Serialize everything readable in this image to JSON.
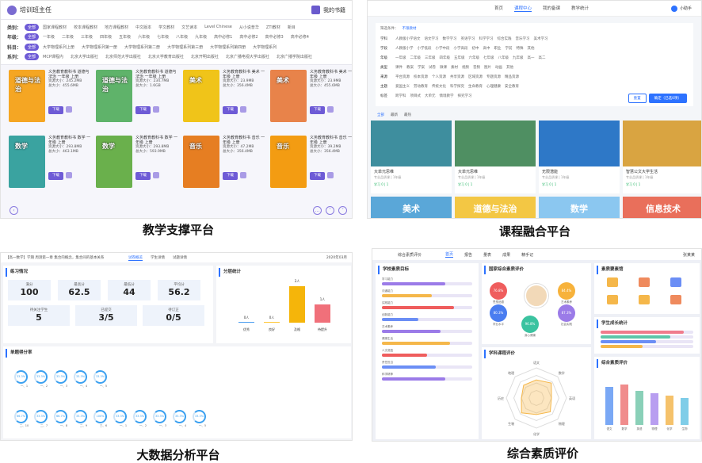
{
  "captions": {
    "p1": "教学支撑平台",
    "p2": "课程融合平台",
    "p3": "大数据分析平台",
    "p4": "综合素质评价"
  },
  "p1": {
    "user": "培训班主任",
    "shelf": "我的书籍",
    "filters": [
      {
        "label": "类别：",
        "all": "全部",
        "options": [
          "国家课程教材",
          "校本课程教材",
          "地方课程教材",
          "中文版本",
          "学文教材",
          "文艺读本",
          "Level Chinese",
          "从小说普华",
          "ZTI教材",
          "新目"
        ]
      },
      {
        "label": "年级：",
        "all": "全部",
        "options": [
          "一年级",
          "二年级",
          "三年级",
          "四年级",
          "五年级",
          "六年级",
          "七年级",
          "八年级",
          "九年级",
          "高中必修1",
          "高中必修2",
          "高中必修3",
          "高中必修4"
        ]
      },
      {
        "label": "科目：",
        "all": "全部",
        "options": [
          "大学物理系列上册",
          "大学物理系列第一册",
          "大学物理系列第二册",
          "大学物理系列第三册",
          "大学物理系列第四册",
          "大学物理系列"
        ]
      },
      {
        "label": "系列：",
        "all": "全部",
        "options": [
          "MCP课程内",
          "北京大学出版社",
          "北京师范大学出版社",
          "北京大学教育出版社",
          "北京开明出版社",
          "北京广播电视大学出版社",
          "北京广播学院出版社"
        ]
      }
    ],
    "books": [
      {
        "cover": "道德与法治",
        "title": "义务教育教科书 道德与法治 一年级 上册",
        "size1": "245.2MB",
        "size2": "455.6MB",
        "color": "#f5a623"
      },
      {
        "cover": "道德与法治",
        "title": "义务教育教科书 道德与法治 一年级 上册",
        "size1": "234.7MB",
        "size2": "1.6GB",
        "color": "#5fb36a"
      },
      {
        "cover": "美术",
        "title": "义务教育教科书 美术 一年级 上册",
        "size1": "23.9MB",
        "size2": "356.4MB",
        "color": "#f0c419"
      },
      {
        "cover": "美术",
        "title": "义务教育教科书 美术 一年级 上册",
        "size1": "23.9MB",
        "size2": "455.6MB",
        "color": "#e8834a"
      },
      {
        "cover": "数学",
        "title": "义务教育教科书 数学 一年级 上册",
        "size1": "293.8MB",
        "size2": "463.1MB",
        "color": "#3aa3a0"
      },
      {
        "cover": "数学",
        "title": "义务教育教科书 数学 一年级 上册",
        "size1": "293.8MB",
        "size2": "593.9MB",
        "color": "#6ab04c"
      },
      {
        "cover": "音乐",
        "title": "义务教育教科书 音乐 一年级 上册",
        "size1": "47.2MB",
        "size2": "356.4MB",
        "color": "#e67e22"
      },
      {
        "cover": "音乐",
        "title": "义务教育教科书 音乐 一年级 上册",
        "size1": "39.2MB",
        "size2": "356.4MB",
        "color": "#f39c12"
      }
    ],
    "download": "下载",
    "size_label1": "资源大小：",
    "size_label2": "总大小："
  },
  "p2": {
    "nav": [
      "首页",
      "课程中心",
      "我的备课",
      "教学统计"
    ],
    "nav_active": 1,
    "user": "小助手",
    "filter_label": "筛选条件：",
    "filter_sel": "不限教材",
    "rows": [
      {
        "label": "学科",
        "opts": [
          "人教版小学语文",
          "语文学习",
          "数学学习",
          "英语学习",
          "科学学习",
          "综合实践",
          "音乐学习",
          "美术学习"
        ]
      },
      {
        "label": "学段",
        "opts": [
          "人教版小学",
          "小学低段",
          "小学中段",
          "小学高段",
          "初中",
          "高中",
          "职业",
          "学前",
          "特殊",
          "其他"
        ]
      },
      {
        "label": "年级",
        "opts": [
          "一年级",
          "二年级",
          "三年级",
          "四年级",
          "五年级",
          "六年级",
          "七年级",
          "八年级",
          "九年级",
          "高一",
          "高二"
        ]
      },
      {
        "label": "类型",
        "opts": [
          "课件",
          "教案",
          "学案",
          "试卷",
          "微课",
          "素材",
          "视频",
          "音频",
          "图片",
          "动画",
          "其他"
        ]
      },
      {
        "label": "来源",
        "opts": [
          "平台资源",
          "校本资源",
          "个人资源",
          "共享资源",
          "区域资源",
          "专题资源",
          "精品资源"
        ]
      },
      {
        "label": "主题",
        "opts": [
          "爱国主义",
          "劳动教育",
          "传统文化",
          "科学探究",
          "生命教育",
          "心理健康",
          "安全教育"
        ]
      },
      {
        "label": "标签",
        "opts": [
          "跨学科",
          "项目式",
          "大单元",
          "情境教学",
          "探究学习"
        ]
      }
    ],
    "btn_reset": "重置",
    "btn_ok": "确定（已选0项）",
    "tabs": [
      "全部",
      "最新",
      "最热"
    ],
    "cards": [
      {
        "title": "大单元思维",
        "meta": "专业品质课 | 1年级",
        "tag": "学习 0 | 1",
        "color": "#3e8e9e"
      },
      {
        "title": "大单元思维",
        "meta": "专业品质课 | 1年级",
        "tag": "学习 0 | 1",
        "color": "#4f8f62"
      },
      {
        "title": "无限潜能",
        "meta": "专业品质课 | 1年级",
        "tag": "学习 0 | 1",
        "color": "#2e78c7"
      },
      {
        "title": "智慧公文大学生活",
        "meta": "专业品质课 | 1年级",
        "tag": "学习 0 | 1",
        "color": "#d9a441"
      }
    ],
    "row2": [
      "美术",
      "道德与法治",
      "数学",
      "信息技术"
    ]
  },
  "p3": {
    "crumb": "【高一数学】学期 周测第一章 集合的概念，集合间的基本关系",
    "tabs": [
      "试卷概览",
      "学生详情",
      "试题详情"
    ],
    "tab_active": 0,
    "date": "2020年03月",
    "section1": "练习情况",
    "stats": [
      {
        "label": "满分",
        "value": "100"
      },
      {
        "label": "最高分",
        "value": "62.5"
      },
      {
        "label": "最低分",
        "value": "44"
      },
      {
        "label": "平均分",
        "value": "56.2"
      }
    ],
    "stats2": [
      {
        "label": "待关注学生",
        "value": "5"
      },
      {
        "label": "已提交",
        "value": "3/5"
      },
      {
        "label": "待订正",
        "value": "0/5"
      }
    ],
    "section2": "分层统计",
    "chart_data": {
      "type": "bar",
      "categories": [
        "优秀",
        "良好",
        "及格",
        "待提升"
      ],
      "values": [
        0,
        0,
        2,
        1
      ],
      "labels": [
        "0人",
        "0人",
        "2人",
        "1人"
      ],
      "colors": [
        "#4a9df0",
        "#ffc736",
        "#f5b50a",
        "#f0707a"
      ]
    },
    "section3": "单题得分率",
    "ring_vals": [
      "33.3%",
      "33.3%",
      "33.3%",
      "33.3%",
      "33.3%"
    ],
    "ring_labels": [
      "一、1",
      "一、2",
      "一、3",
      "一、4",
      "一、5"
    ],
    "ring_vals2": [
      "66.7%",
      "33.3%",
      "66.7%",
      "33.3%",
      "100%",
      "33.3%",
      "33.3%",
      "33.3%",
      "33.3%",
      "33.3%"
    ],
    "ring_labels2": [
      "二、10",
      "二、7",
      "一、8",
      "二、9",
      "三、6",
      "一、1",
      "一、2",
      "一、3",
      "一、4",
      "一、5"
    ]
  },
  "p4": {
    "title": "综合素质评价",
    "nav": [
      "首页",
      "报告",
      "量表",
      "成果",
      "精手记"
    ],
    "nav_active": 0,
    "user": "张某某",
    "col1": "学校素质目标",
    "col2": "国家综合素质评价",
    "col3": "素质要素馆",
    "bars": [
      {
        "l": "学习能力",
        "v": 0.7
      },
      {
        "l": "沟通能力",
        "v": 0.55
      },
      {
        "l": "实践能力",
        "v": 0.8
      },
      {
        "l": "创新能力",
        "v": 0.4
      },
      {
        "l": "艺术素养",
        "v": 0.65
      },
      {
        "l": "健康生活",
        "v": 0.75
      },
      {
        "l": "人文底蕴",
        "v": 0.5
      },
      {
        "l": "责任担当",
        "v": 0.6
      },
      {
        "l": "科学精神",
        "v": 0.7
      }
    ],
    "circles": [
      {
        "v": "76.8%",
        "l": "思想品德",
        "c": "#ef5d5d"
      },
      {
        "v": "80.3%",
        "l": "学业水平",
        "c": "#4a7df0"
      },
      {
        "v": "96.8%",
        "l": "身心健康",
        "c": "#3bc3a0"
      },
      {
        "v": "84.4%",
        "l": "艺术素养",
        "c": "#f7b23b"
      },
      {
        "v": "87.3%",
        "l": "社会实践",
        "c": "#9b7be8"
      }
    ],
    "radar_title": "学科课程评价",
    "radar_labels": [
      "语文",
      "数学",
      "英语",
      "物理",
      "化学",
      "生物",
      "历史",
      "地理"
    ],
    "col4": "学生成长统计",
    "col5": "综合素质评价",
    "chart_data": {
      "type": "bar",
      "categories": [
        "语文",
        "数学",
        "英语",
        "物理",
        "化学",
        "生物"
      ],
      "values": [
        78,
        82,
        70,
        65,
        60,
        55
      ],
      "ylim": [
        0,
        100
      ],
      "colors": [
        "#7aa8f5",
        "#f08c8c",
        "#8ad0b8",
        "#b89ef0",
        "#f5c26b",
        "#7fcde8"
      ]
    },
    "hbars": [
      {
        "v": 0.9,
        "c": "#f07c8c"
      },
      {
        "v": 0.75,
        "c": "#5cc6a8"
      },
      {
        "v": 0.6,
        "c": "#6b8ef5"
      },
      {
        "v": 0.45,
        "c": "#f5b74a"
      }
    ]
  }
}
